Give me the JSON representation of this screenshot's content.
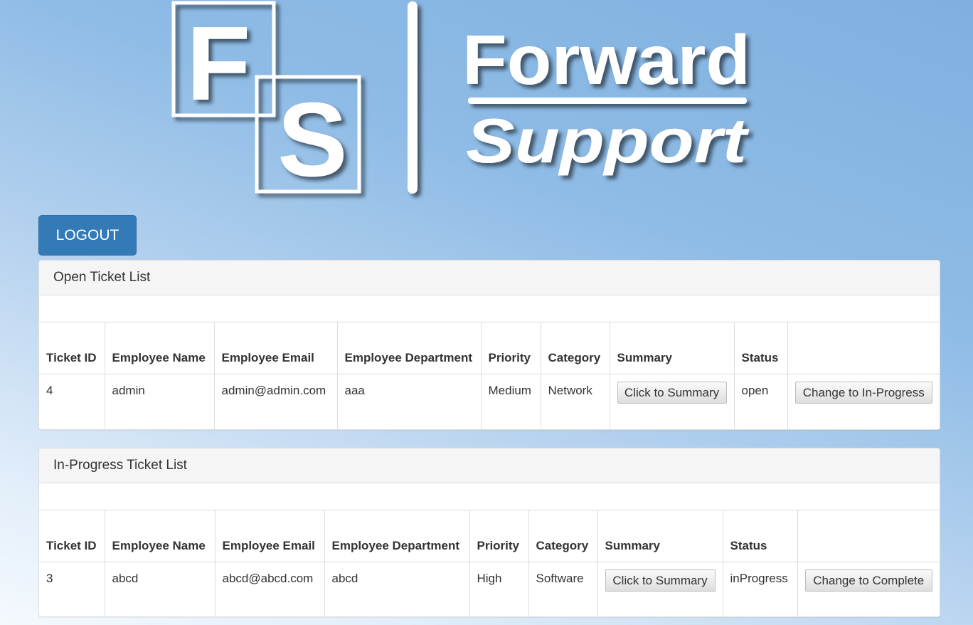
{
  "logo": {
    "letter_f": "F",
    "letter_s": "S",
    "word_1": "Forward",
    "word_2": "Support"
  },
  "logout_label": "LOGOUT",
  "open_panel": {
    "title": "Open Ticket List",
    "headers": {
      "ticket_id": "Ticket ID",
      "employee_name": "Employee Name",
      "employee_email": "Employee Email",
      "employee_department": "Employee Department",
      "priority": "Priority",
      "category": "Category",
      "summary": "Summary",
      "status": "Status"
    },
    "rows": [
      {
        "ticket_id": "4",
        "employee_name": "admin",
        "employee_email": "admin@admin.com",
        "employee_department": "aaa",
        "priority": "Medium",
        "category": "Network",
        "summary_button": "Click to Summary",
        "status": "open",
        "action_button": "Change to In-Progress"
      }
    ]
  },
  "inprogress_panel": {
    "title": "In-Progress Ticket List",
    "headers": {
      "ticket_id": "Ticket ID",
      "employee_name": "Employee Name",
      "employee_email": "Employee Email",
      "employee_department": "Employee Department",
      "priority": "Priority",
      "category": "Category",
      "summary": "Summary",
      "status": "Status"
    },
    "rows": [
      {
        "ticket_id": "3",
        "employee_name": "abcd",
        "employee_email": "abcd@abcd.com",
        "employee_department": "abcd",
        "priority": "High",
        "category": "Software",
        "summary_button": "Click to Summary",
        "status": "inProgress",
        "action_button": "Change to Complete"
      }
    ]
  }
}
